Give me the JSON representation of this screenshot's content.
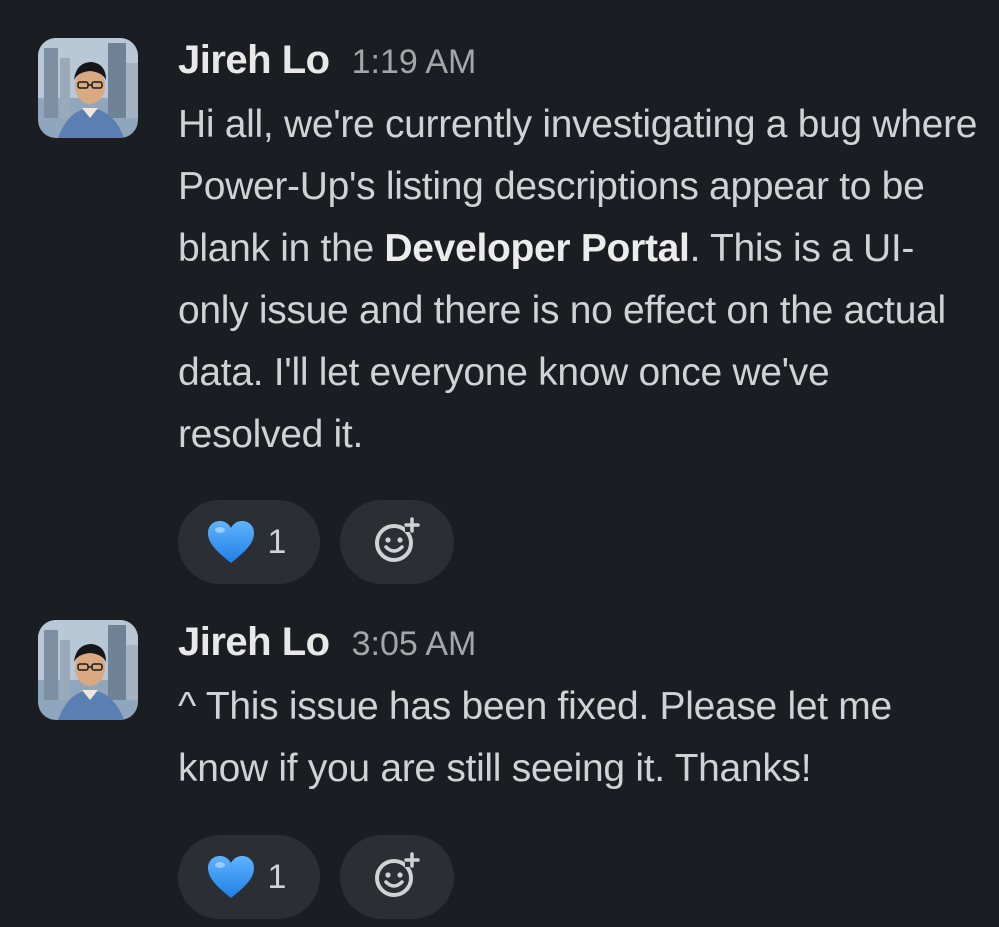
{
  "messages": [
    {
      "author": "Jireh Lo",
      "time": "1:19 AM",
      "text_before": "Hi all, we're currently investigating a bug where Power-Up's listing descriptions appear to be blank in the ",
      "text_bold": "Developer Portal",
      "text_after": ". This is a UI-only issue and there is no effect on the actual data. I'll let everyone know once we've resolved it.",
      "reaction": {
        "icon": "blue-heart-icon",
        "count": "1"
      }
    },
    {
      "author": "Jireh Lo",
      "time": "3:05 AM",
      "text": "^ This issue has been fixed. Please let me know if you are still seeing it. Thanks!",
      "reaction": {
        "icon": "blue-heart-icon",
        "count": "1"
      }
    }
  ],
  "icons": {
    "add_reaction": "add-reaction-icon"
  },
  "colors": {
    "background": "#1a1d21",
    "pill": "#2b2e33",
    "heart": "#3d9cf5"
  }
}
